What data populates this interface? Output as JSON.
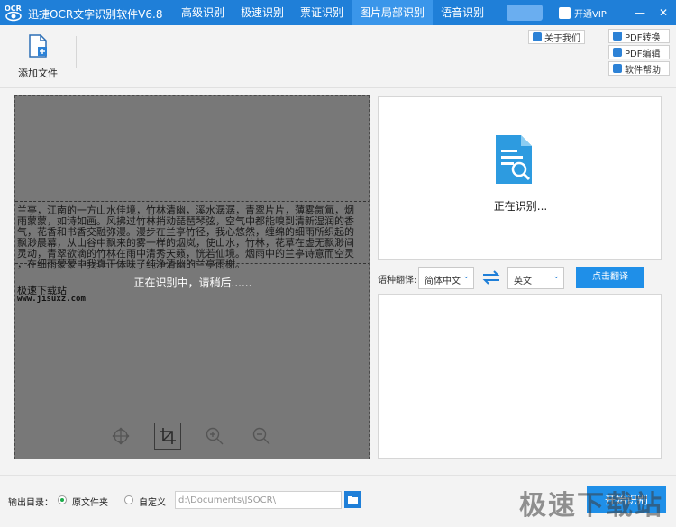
{
  "titlebar": {
    "logo_text": "OCR",
    "app_title": "迅捷OCR文字识别软件V6.8",
    "tabs": [
      {
        "label": "高级识别"
      },
      {
        "label": "极速识别"
      },
      {
        "label": "票证识别"
      },
      {
        "label": "图片局部识别"
      },
      {
        "label": "语音识别"
      }
    ],
    "active_tab": "图片局部识别",
    "vip_label": "开通VIP",
    "minimize": "—",
    "close": "✕"
  },
  "toolbar": {
    "add_file_label": "添加文件",
    "about_label": "关于我们",
    "pdf_convert_label": "PDF转换",
    "pdf_edit_label": "PDF编辑",
    "help_label": "软件帮助"
  },
  "image_panel": {
    "doc_lines": [
      "兰亭，江南的一方山水佳境，竹林清幽，溪水潺潺，青翠片片，薄雾氤氲，烟",
      "雨蒙蒙，如诗如画。风拂过竹林捎动琵琶琴弦，空气中都能嗅到清新湿润的香",
      "气，花香和书香交融弥漫。漫步在兰亭竹径，我心悠然，缠绵的细雨所织起的",
      "飘渺晨幕，从山谷中飘来的雾一样的烟岚，使山水，竹林，花草在虚无飘渺间",
      "灵动，青翠欲滴的竹林在雨中清秀天籁，恍若仙境。烟雨中的兰亭诗意而空灵",
      "，在细雨蒙蒙中我真正体味了纯净清幽的兰亭雨榭。"
    ],
    "source_site": "极速下载站",
    "source_url": "www.jisuxz.com",
    "processing_message": "正在识别中，请稍后......",
    "tools": [
      "move-icon",
      "crop-icon",
      "zoom-in-icon",
      "zoom-out-icon"
    ]
  },
  "result_panel": {
    "status": "正在识别..."
  },
  "translation": {
    "label": "语种翻译:",
    "source_lang": "简体中文",
    "target_lang": "英文",
    "translate_button": "点击翻译"
  },
  "bottom": {
    "output_label": "输出目录：",
    "option_original": "原文件夹",
    "option_custom": "自定义",
    "path": "d:\\Documents\\JSOCR\\",
    "start_button": "开始识别"
  },
  "watermark": "极速下载站",
  "colors": {
    "primary": "#1f7fd8",
    "active_tab": "#3a96ea",
    "button": "#1f8fe8",
    "radio_on": "#1cab4a"
  }
}
